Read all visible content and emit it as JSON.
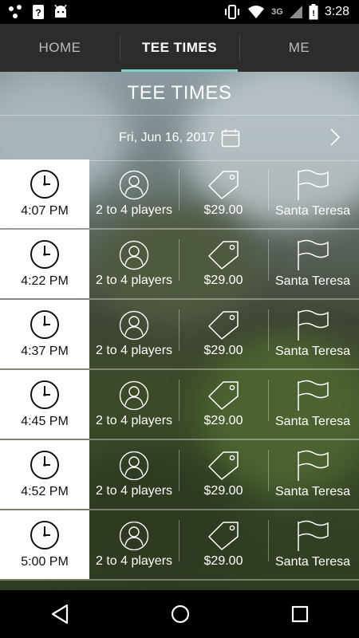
{
  "status_bar": {
    "network": "3G",
    "time": "3:28"
  },
  "tabs": [
    {
      "label": "HOME"
    },
    {
      "label": "TEE TIMES"
    },
    {
      "label": "ME"
    }
  ],
  "page": {
    "title": "TEE TIMES"
  },
  "date_bar": {
    "date": "Fri, Jun 16, 2017"
  },
  "tee_times": [
    {
      "time": "4:07 PM",
      "players": "2 to 4 players",
      "price": "$29.00",
      "course": "Santa Teresa"
    },
    {
      "time": "4:22 PM",
      "players": "2 to 4 players",
      "price": "$29.00",
      "course": "Santa Teresa"
    },
    {
      "time": "4:37 PM",
      "players": "2 to 4 players",
      "price": "$29.00",
      "course": "Santa Teresa"
    },
    {
      "time": "4:45 PM",
      "players": "2 to 4 players",
      "price": "$29.00",
      "course": "Santa Teresa"
    },
    {
      "time": "4:52 PM",
      "players": "2 to 4 players",
      "price": "$29.00",
      "course": "Santa Teresa"
    },
    {
      "time": "5:00 PM",
      "players": "2 to 4 players",
      "price": "$29.00",
      "course": "Santa Teresa"
    }
  ],
  "colors": {
    "accent": "#7fd0c6",
    "tab_bar": "#2c2c2c"
  },
  "icons": {
    "time": "clock-icon",
    "players": "person-icon",
    "price": "price-tag-icon",
    "course": "flag-icon"
  }
}
